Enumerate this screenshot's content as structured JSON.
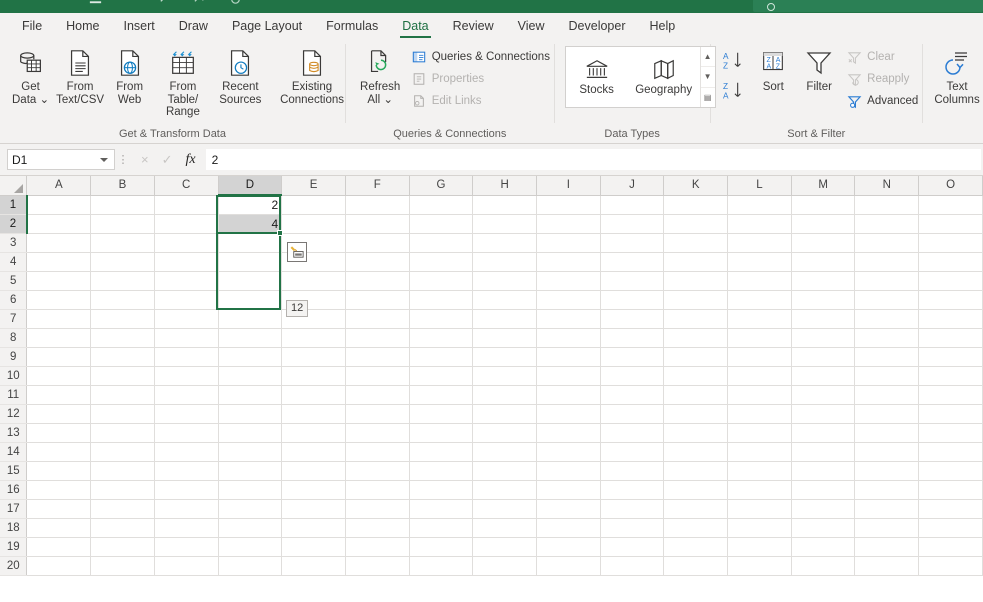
{
  "window": {
    "app": "Microsoft Excel",
    "accent_color": "#217346",
    "selection_color": "#217346"
  },
  "ribbon": {
    "tabs": [
      {
        "label": "File",
        "active": false
      },
      {
        "label": "Home",
        "active": false
      },
      {
        "label": "Insert",
        "active": false
      },
      {
        "label": "Draw",
        "active": false
      },
      {
        "label": "Page Layout",
        "active": false
      },
      {
        "label": "Formulas",
        "active": false
      },
      {
        "label": "Data",
        "active": true
      },
      {
        "label": "Review",
        "active": false
      },
      {
        "label": "View",
        "active": false
      },
      {
        "label": "Developer",
        "active": false
      },
      {
        "label": "Help",
        "active": false
      }
    ],
    "groups": {
      "get_transform": {
        "label": "Get & Transform Data",
        "buttons": [
          {
            "label": "Get\nData ⌄",
            "icon": "database-table-icon"
          },
          {
            "label": "From\nText/CSV",
            "icon": "text-file-icon"
          },
          {
            "label": "From\nWeb",
            "icon": "web-globe-file-icon"
          },
          {
            "label": "From Table/\nRange",
            "icon": "table-range-icon"
          },
          {
            "label": "Recent\nSources",
            "icon": "recent-clock-file-icon"
          },
          {
            "label": "Existing\nConnections",
            "icon": "existing-connections-icon"
          }
        ]
      },
      "queries_connections": {
        "label": "Queries & Connections",
        "refresh": {
          "label": "Refresh\nAll ⌄",
          "icon": "refresh-all-icon"
        },
        "items": [
          {
            "label": "Queries & Connections",
            "icon": "queries-pane-icon",
            "disabled": false
          },
          {
            "label": "Properties",
            "icon": "properties-icon",
            "disabled": true
          },
          {
            "label": "Edit Links",
            "icon": "edit-links-icon",
            "disabled": true
          }
        ]
      },
      "data_types": {
        "label": "Data Types",
        "items": [
          {
            "label": "Stocks",
            "icon": "bank-stocks-icon"
          },
          {
            "label": "Geography",
            "icon": "map-geography-icon"
          }
        ],
        "scroll": [
          "▲",
          "▼",
          "▤"
        ]
      },
      "sort_filter": {
        "label": "Sort & Filter",
        "sort_asc": {
          "icon": "sort-az-icon"
        },
        "sort_desc": {
          "icon": "sort-za-icon"
        },
        "sort": {
          "label": "Sort",
          "icon": "sort-dialog-icon"
        },
        "filter": {
          "label": "Filter",
          "icon": "funnel-filter-icon"
        },
        "items": [
          {
            "label": "Clear",
            "icon": "clear-filter-icon",
            "disabled": true
          },
          {
            "label": "Reapply",
            "icon": "reapply-filter-icon",
            "disabled": true
          },
          {
            "label": "Advanced",
            "icon": "advanced-filter-icon",
            "disabled": false
          }
        ]
      },
      "data_tools": {
        "label": "",
        "text_to_columns": {
          "label": "Text\nColumns",
          "icon": "text-to-columns-icon"
        }
      }
    }
  },
  "formula_bar": {
    "name_box": "D1",
    "cancel_icon": "×",
    "enter_icon": "✓",
    "function_icon": "fx",
    "value": "2"
  },
  "grid": {
    "columns": [
      "A",
      "B",
      "C",
      "D",
      "E",
      "F",
      "G",
      "H",
      "I",
      "J",
      "K",
      "L",
      "M",
      "N",
      "O"
    ],
    "selected_column": "D",
    "rows": [
      1,
      2,
      3,
      4,
      5,
      6,
      7,
      8,
      9,
      10,
      11,
      12,
      13,
      14,
      15,
      16,
      17,
      18,
      19,
      20
    ],
    "selected_rows": [
      1,
      2
    ],
    "cells": [
      {
        "ref": "D1",
        "value": "2",
        "active": true
      },
      {
        "ref": "D2",
        "value": "4",
        "active": false
      }
    ],
    "selection_range": "D1:D6",
    "active_cell": "D1",
    "autofill_button": {
      "icon": "autofill-options-icon",
      "near_cell": "E3"
    },
    "drag_tooltip": {
      "text": "12",
      "near_cell": "E6"
    }
  }
}
